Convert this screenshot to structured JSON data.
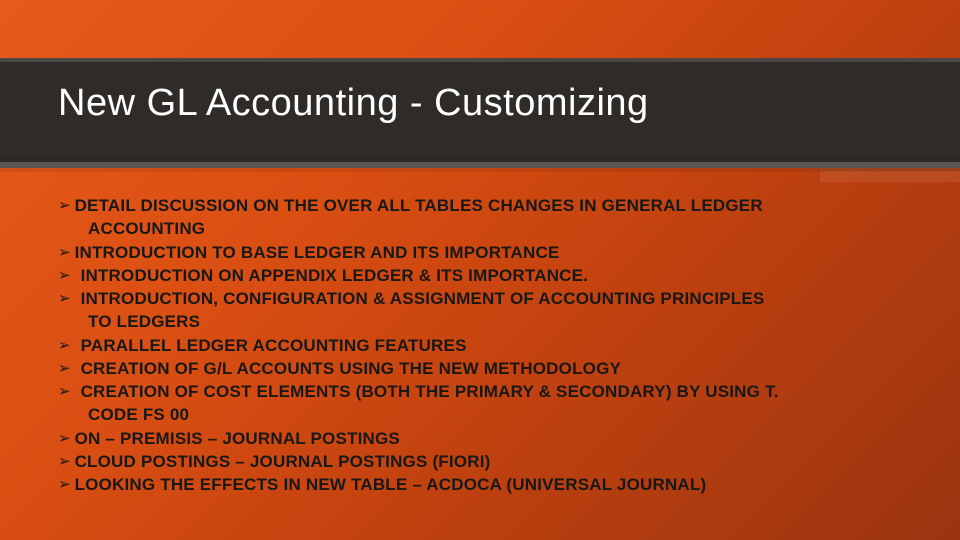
{
  "title": "New GL Accounting  - Customizing",
  "bullets": [
    {
      "line1": "DETAIL DISCUSSION ON THE OVER ALL TABLES CHANGES IN GENERAL LEDGER",
      "line2": "ACCOUNTING",
      "pad": false
    },
    {
      "line1": "INTRODUCTION TO BASE LEDGER AND ITS IMPORTANCE",
      "line2": null,
      "pad": false
    },
    {
      "line1": "INTRODUCTION ON APPENDIX LEDGER & ITS IMPORTANCE.",
      "line2": null,
      "pad": true
    },
    {
      "line1": "INTRODUCTION, CONFIGURATION & ASSIGNMENT OF ACCOUNTING PRINCIPLES",
      "line2": "TO LEDGERS",
      "pad": true
    },
    {
      "line1": "PARALLEL LEDGER ACCOUNTING FEATURES",
      "line2": null,
      "pad": true
    },
    {
      "line1": "CREATION OF G/L ACCOUNTS USING THE NEW METHODOLOGY",
      "line2": null,
      "pad": true
    },
    {
      "line1": "CREATION OF COST ELEMENTS (BOTH THE PRIMARY & SECONDARY) BY USING T.",
      "line2": "CODE FS 00",
      "pad": true
    },
    {
      "line1": "ON – PREMISIS – JOURNAL POSTINGS",
      "line2": null,
      "pad": false
    },
    {
      "line1": "CLOUD POSTINGS – JOURNAL POSTINGS (FIORI)",
      "line2": null,
      "pad": false
    },
    {
      "line1": "LOOKING THE EFFECTS IN NEW TABLE – ACDOCA (UNIVERSAL JOURNAL)",
      "line2": null,
      "pad": false
    }
  ],
  "bullet_glyph": "➢"
}
